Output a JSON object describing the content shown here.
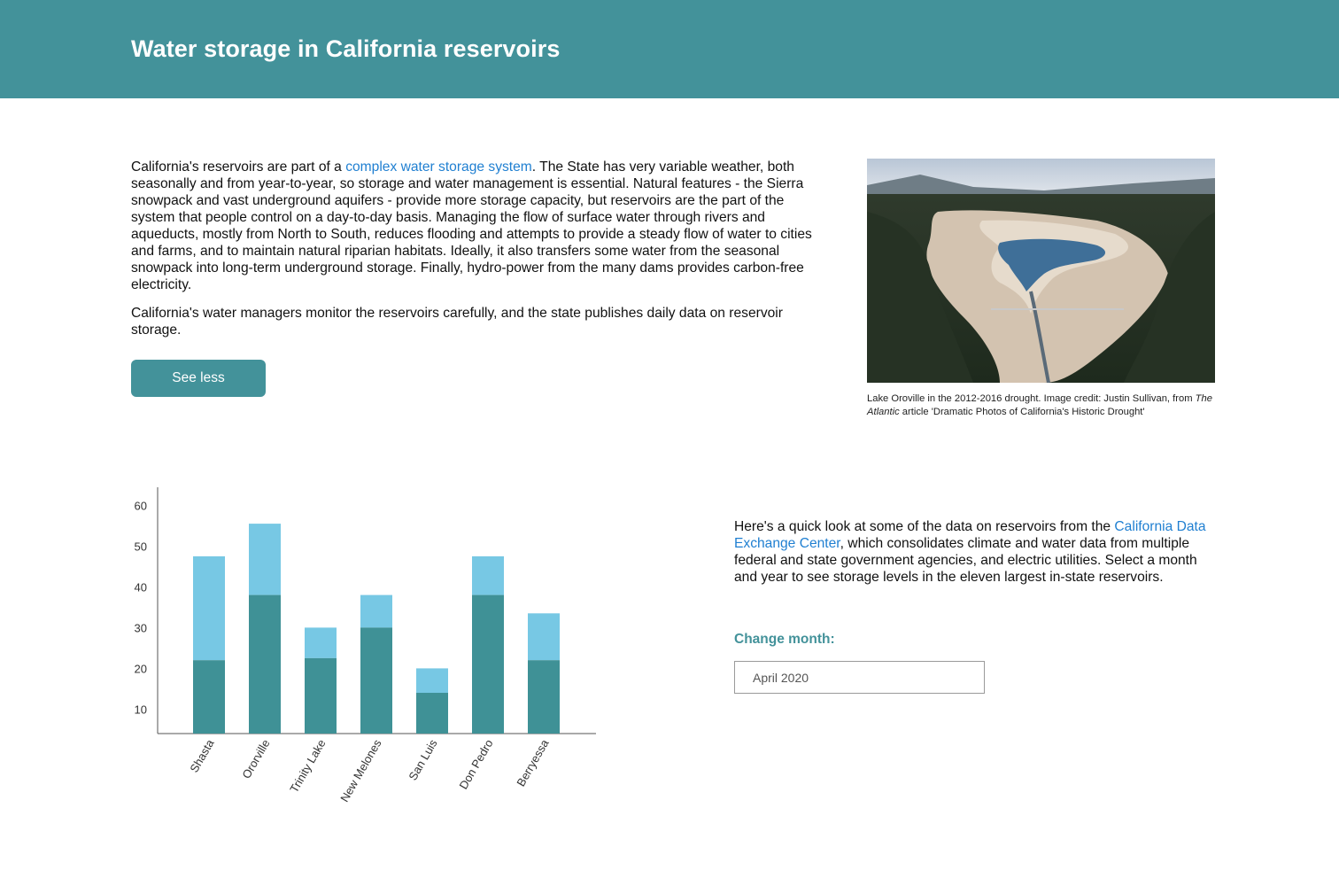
{
  "header": {
    "title": "Water storage in California reservoirs"
  },
  "intro": {
    "p1_before": "California's reservoirs are part of a ",
    "p1_link": "complex water storage system",
    "p1_after": ". The State has very variable weather, both seasonally and from year-to-year, so storage and water management is essential. Natural features - the Sierra snowpack and vast underground aquifers - provide more storage capacity, but reservoirs are the part of the system that people control on a day-to-day basis.  Managing the flow of surface water through rivers and aqueducts, mostly from North to South, reduces flooding and attempts to provide a steady flow of water to cities and farms, and to maintain natural riparian habitats. Ideally, it also transfers some water from the seasonal snowpack into long-term underground storage. Finally, hydro-power from the many dams provides carbon-free electricity.",
    "p2": "California's water managers monitor the reservoirs carefully, and the state publishes daily data on reservoir storage.",
    "button_label": "See less"
  },
  "photo": {
    "caption_before": "Lake Oroville in the 2012-2016 drought. Image credit: Justin Sullivan, from ",
    "caption_italic": "The Atlantic",
    "caption_after": " article 'Dramatic Photos of California's Historic Drought'"
  },
  "info": {
    "text_before": "Here's a quick look at some of the data on reservoirs from the ",
    "link": "California Data Exchange Center",
    "text_after": ", which consolidates climate and water data from multiple federal and state government agencies, and  electric utilities. Select a month and year to see storage levels in the eleven largest in-state reservoirs.",
    "change_label": "Change month:",
    "selected_month": "April 2020"
  },
  "colors": {
    "accent": "#43929a",
    "light_bar": "#77c8e4",
    "dark_bar": "#3f9196",
    "link": "#1f7fd1"
  },
  "chart_data": {
    "type": "bar",
    "categories": [
      "Shasta",
      "Ororville",
      "Trinity Lake",
      "New Melones",
      "San Luis",
      "Don Pedro",
      "Berryessa"
    ],
    "series": [
      {
        "values": [
          22,
          38,
          22.5,
          30,
          14,
          38,
          22
        ]
      },
      {
        "values": [
          47.5,
          55.5,
          30,
          38,
          20,
          47.5,
          33.5
        ]
      }
    ],
    "yticks": [
      10,
      20,
      30,
      40,
      50,
      60
    ],
    "ylim": [
      4,
      64
    ],
    "xlabel": "",
    "ylabel": "",
    "title": ""
  }
}
